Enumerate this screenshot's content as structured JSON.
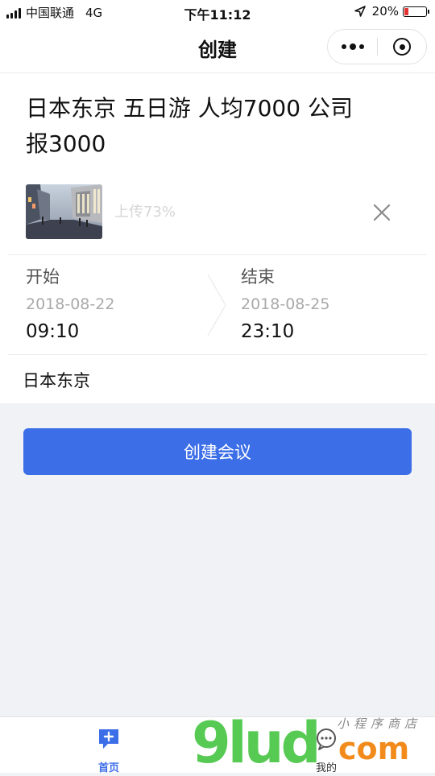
{
  "status_bar": {
    "carrier": "中国联通",
    "network": "4G",
    "time": "下午11:12",
    "battery_percent": "20%",
    "battery_level": 0.2,
    "battery_color": "#e33333"
  },
  "nav": {
    "title": "创建"
  },
  "form": {
    "title": "日本东京 五日游 人均7000 公司报3000",
    "upload_progress": "上传73%",
    "start": {
      "label": "开始",
      "date": "2018-08-22",
      "time": "09:10"
    },
    "end": {
      "label": "结束",
      "date": "2018-08-25",
      "time": "23:10"
    },
    "location": "日本东京"
  },
  "create_button": {
    "label": "创建会议",
    "color": "#3c6ee8"
  },
  "tab_bar": {
    "items": [
      {
        "label": "首页",
        "icon": "chat-plus-icon",
        "active": true
      },
      {
        "label": "我的",
        "icon": "chat-bubble-icon",
        "active": false
      }
    ]
  },
  "watermark": {
    "main": "9lud",
    "domain": "com",
    "slogan": "小程序商店"
  }
}
